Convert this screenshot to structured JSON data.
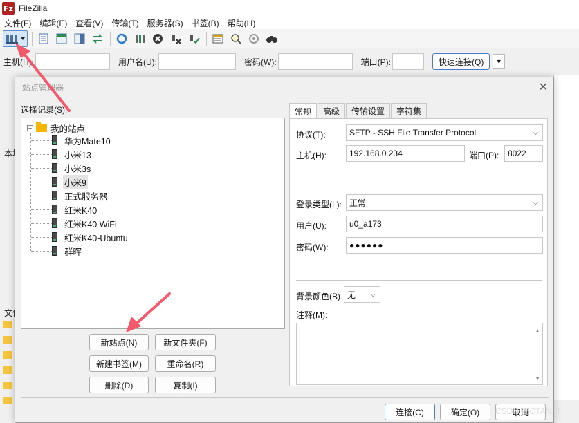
{
  "app": {
    "icon_letter": "Fz",
    "title": "FileZilla"
  },
  "menu": [
    "文件(F)",
    "编辑(E)",
    "查看(V)",
    "传输(T)",
    "服务器(S)",
    "书签(B)",
    "帮助(H)"
  ],
  "quickconnect": {
    "host_label": "主机(H):",
    "user_label": "用户名(U):",
    "pass_label": "密码(W):",
    "port_label": "端口(P):",
    "connect_label": "快速连接(Q)"
  },
  "background": {
    "local_label": "本地",
    "file_label": "文件"
  },
  "dialog": {
    "title": "站点管理器",
    "select_label": "选择记录(S):",
    "root_label": "我的站点",
    "sites": [
      "华为Mate10",
      "小米13",
      "小米3s",
      "小米9",
      "正式服务器",
      "红米K40",
      "红米K40 WiFi",
      "红米K40-Ubuntu",
      "群晖"
    ],
    "selected_site": "小米9",
    "buttons": {
      "new_site": "新站点(N)",
      "new_folder": "新文件夹(F)",
      "new_bookmark": "新建书签(M)",
      "rename": "重命名(R)",
      "delete": "删除(D)",
      "copy": "复制(I)"
    },
    "tabs": [
      "常规",
      "高级",
      "传输设置",
      "字符集"
    ],
    "general": {
      "protocol_label": "协议(T):",
      "protocol_value": "SFTP - SSH File Transfer Protocol",
      "host_label": "主机(H):",
      "host_value": "192.168.0.234",
      "port_label": "端口(P):",
      "port_value": "8022",
      "login_type_label": "登录类型(L):",
      "login_type_value": "正常",
      "user_label": "用户(U):",
      "user_value": "u0_a173",
      "password_label": "密码(W):",
      "password_value": "●●●●●●",
      "bg_color_label": "背景颜色(B)",
      "bg_color_value": "无",
      "comment_label": "注释(M):"
    },
    "footer": {
      "connect": "连接(C)",
      "ok": "确定(O)",
      "cancel": "取消"
    }
  },
  "watermark": "CSDN @CTAN.IT",
  "colors": {
    "accent": "#4a7bd1",
    "arrow": "#f05a6a",
    "folder": "#f4b400"
  }
}
